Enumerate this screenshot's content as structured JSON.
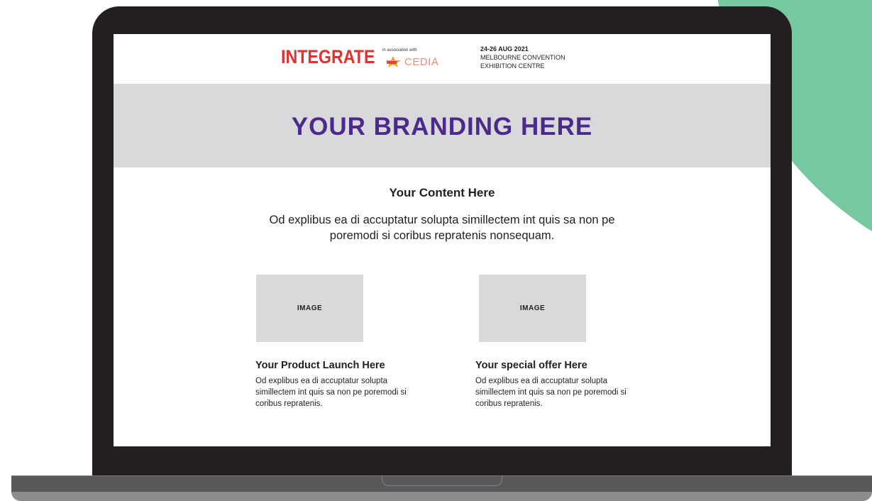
{
  "colors": {
    "accent_green": "#76c8a0",
    "brand_purple": "#4b2a8b",
    "integrate_red": "#e0312d",
    "band_gray": "#d9d9dc",
    "laptop_black": "#231f20"
  },
  "header": {
    "logo_text": "INTEGRATE",
    "association_text": "in association with",
    "partner_text": "CEDIA",
    "event_date": "24-26 AUG 2021",
    "venue_line1": "MELBOURNE CONVENTION",
    "venue_line2": "EXHIBITION CENTRE"
  },
  "branding": {
    "text": "YOUR BRANDING HERE"
  },
  "main": {
    "title": "Your Content Here",
    "body": "Od explibus ea di accuptatur solupta simillectem int quis sa non pe poremodi si coribus repratenis nonsequam."
  },
  "cards": [
    {
      "image_label": "IMAGE",
      "title": "Your Product Launch Here",
      "body": "Od explibus ea di accuptatur solupta simillectem int quis sa non pe poremodi si coribus repratenis."
    },
    {
      "image_label": "IMAGE",
      "title": "Your special offer Here",
      "body": "Od explibus ea di accuptatur solupta simillectem int quis sa non pe poremodi si coribus repratenis."
    }
  ]
}
